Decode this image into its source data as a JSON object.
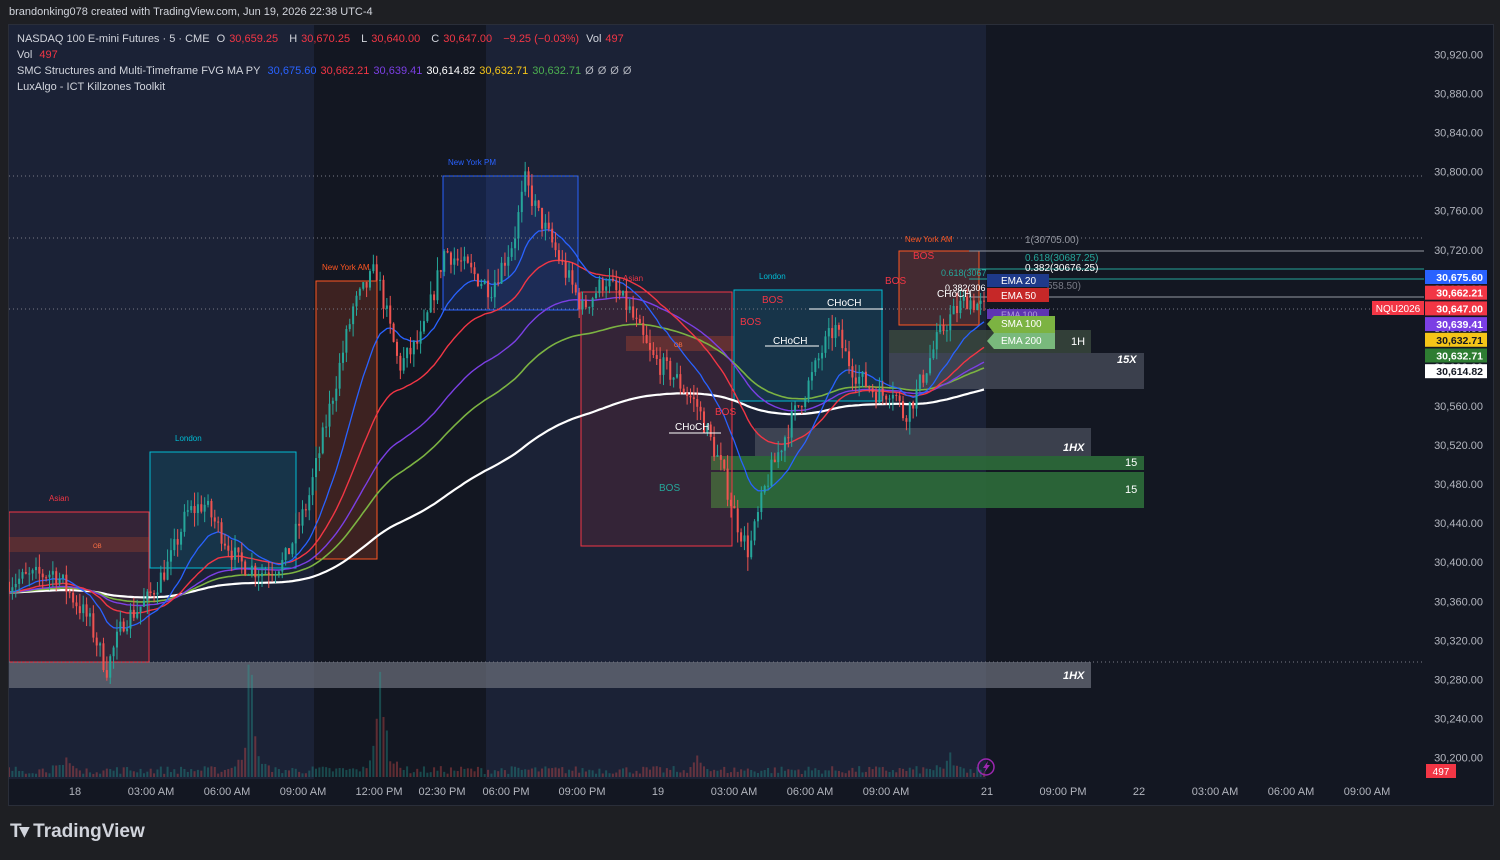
{
  "attribution": "brandonking078 created with TradingView.com, Jun 19, 2026 22:38 UTC-4",
  "legend": {
    "symbol": "NASDAQ 100 E-mini Futures · 5 · CME",
    "o_label": "O",
    "o": "30,659.25",
    "h_label": "H",
    "h": "30,670.25",
    "l_label": "L",
    "l": "30,640.00",
    "c_label": "C",
    "c": "30,647.00",
    "change": "−9.25 (−0.03%)",
    "vol_label": "Vol",
    "vol": "497",
    "vol_row_label": "Vol",
    "vol_row_value": "497",
    "indicator1": "SMC Structures and Multi-Timeframe FVG MA PY",
    "indicator1_values": [
      {
        "text": "30,675.60",
        "color": "#2962ff"
      },
      {
        "text": "30,662.21",
        "color": "#f23645"
      },
      {
        "text": "30,639.41",
        "color": "#7b3fe4"
      },
      {
        "text": "30,614.82",
        "color": "#ffffff"
      },
      {
        "text": "30,632.71",
        "color": "#f5c518"
      },
      {
        "text": "30,632.71",
        "color": "#4caf50"
      },
      {
        "text": "Ø",
        "color": "#b2b5be"
      },
      {
        "text": "Ø",
        "color": "#b2b5be"
      },
      {
        "text": "Ø",
        "color": "#b2b5be"
      },
      {
        "text": "Ø",
        "color": "#b2b5be"
      }
    ],
    "indicator2": "LuxAlgo - ICT Killzones Toolkit"
  },
  "price_axis": {
    "ticks": [
      "30,920.00",
      "30,880.00",
      "30,840.00",
      "30,800.00",
      "30,760.00",
      "30,720.00",
      "30,680.00",
      "30,640.00",
      "30,600.00",
      "30,560.00",
      "30,520.00",
      "30,480.00",
      "30,440.00",
      "30,400.00",
      "30,360.00",
      "30,320.00",
      "30,280.00",
      "30,240.00",
      "30,200.00"
    ],
    "badges": [
      {
        "text": "30,675.60",
        "color": "#2962ff",
        "value": 30675.6
      },
      {
        "text": "30,662.21",
        "color": "#f23645",
        "value": 30662.21
      },
      {
        "text": "30,647.00",
        "color": "#f23645",
        "value": 30647
      },
      {
        "text": "30,639.41",
        "color": "#7b3fe4",
        "value": 30639.41
      },
      {
        "text": "30,632.71",
        "color": "#f5c518",
        "value": 30632.71
      },
      {
        "text": "30,632.71",
        "color": "#2e7d32",
        "value": 30632.71
      },
      {
        "text": "30,614.82",
        "color": "#ffffff",
        "value": 30614.82
      }
    ],
    "symbol_badge": "NQU2026",
    "volume_badge": "497"
  },
  "time_axis": {
    "labels": [
      "18",
      "03:00 AM",
      "06:00 AM",
      "09:00 AM",
      "12:00 PM",
      "02:30 PM",
      "06:00 PM",
      "09:00 PM",
      "19",
      "03:00 AM",
      "06:00 AM",
      "09:00 AM",
      "21",
      "09:00 PM",
      "22",
      "03:00 AM",
      "06:00 AM",
      "09:00 AM"
    ]
  },
  "sessions": [
    {
      "label": "Asian",
      "color": "#f23645"
    },
    {
      "label": "London",
      "color": "#00bcd4"
    },
    {
      "label": "New York AM",
      "color": "#ff5722"
    },
    {
      "label": "New York PM",
      "color": "#2962ff"
    },
    {
      "label": "Asian",
      "color": "#f23645"
    },
    {
      "label": "London",
      "color": "#00bcd4"
    },
    {
      "label": "New York AM",
      "color": "#ff5722"
    }
  ],
  "structure_labels": [
    "OB",
    "OB",
    "CHoCH",
    "BOS",
    "BOS",
    "BOS",
    "CHoCH",
    "BOS",
    "CHoCH",
    "BOS",
    "BOS",
    "CHoCH"
  ],
  "fib_labels": [
    "1(30705.00)",
    "0.618(30687.25)",
    "0.382(30676.25)",
    "0.618(3067",
    "0.382(306",
    "558.50)"
  ],
  "ma_labels": [
    "EMA 20",
    "EMA 50",
    "EMA 100",
    "SMA 100",
    "EMA 200"
  ],
  "fvg_labels": [
    "1H",
    "15X",
    "1HX",
    "15",
    "15",
    "1HX"
  ],
  "footer": {
    "logo_text": "TradingView"
  },
  "chart_data": {
    "type": "candlestick",
    "title": "NASDAQ 100 E-mini Futures · 5 · CME",
    "ylim": [
      30180,
      30940
    ],
    "last_close": 30647,
    "series": [
      {
        "name": "SMC Structures and Multi-Timeframe FVG MA PY (EMA 20)",
        "last": 30675.6,
        "color": "#2962ff"
      },
      {
        "name": "SMC Structures and Multi-Timeframe FVG MA PY (EMA 50)",
        "last": 30662.21,
        "color": "#f23645"
      },
      {
        "name": "SMC Structures and Multi-Timeframe FVG MA PY (EMA 100)",
        "last": 30639.41,
        "color": "#7b3fe4"
      },
      {
        "name": "SMC Structures and Multi-Timeframe FVG MA PY (SMA 100)",
        "last": 30632.71,
        "color": "#f5c518"
      },
      {
        "name": "SMC Structures and Multi-Timeframe FVG MA PY (EMA 200)",
        "last": 30614.82,
        "color": "#ffffff"
      }
    ],
    "price_path": [
      [
        0,
        30380
      ],
      [
        0.04,
        30390
      ],
      [
        0.07,
        30340
      ],
      [
        0.085,
        30290
      ],
      [
        0.1,
        30340
      ],
      [
        0.12,
        30360
      ],
      [
        0.14,
        30400
      ],
      [
        0.155,
        30450
      ],
      [
        0.17,
        30460
      ],
      [
        0.19,
        30420
      ],
      [
        0.2,
        30400
      ],
      [
        0.22,
        30390
      ],
      [
        0.24,
        30400
      ],
      [
        0.26,
        30460
      ],
      [
        0.28,
        30560
      ],
      [
        0.3,
        30660
      ],
      [
        0.32,
        30700
      ],
      [
        0.34,
        30600
      ],
      [
        0.36,
        30630
      ],
      [
        0.38,
        30720
      ],
      [
        0.4,
        30700
      ],
      [
        0.42,
        30680
      ],
      [
        0.44,
        30730
      ],
      [
        0.45,
        30790
      ],
      [
        0.46,
        30760
      ],
      [
        0.48,
        30710
      ],
      [
        0.5,
        30660
      ],
      [
        0.52,
        30690
      ],
      [
        0.54,
        30660
      ],
      [
        0.56,
        30610
      ],
      [
        0.58,
        30590
      ],
      [
        0.6,
        30560
      ],
      [
        0.62,
        30500
      ],
      [
        0.635,
        30440
      ],
      [
        0.645,
        30410
      ],
      [
        0.66,
        30480
      ],
      [
        0.68,
        30540
      ],
      [
        0.7,
        30590
      ],
      [
        0.71,
        30620
      ],
      [
        0.72,
        30640
      ],
      [
        0.73,
        30610
      ],
      [
        0.74,
        30590
      ],
      [
        0.76,
        30570
      ],
      [
        0.77,
        30580
      ],
      [
        0.78,
        30550
      ],
      [
        0.79,
        30570
      ],
      [
        0.8,
        30600
      ],
      [
        0.81,
        30630
      ],
      [
        0.82,
        30650
      ],
      [
        0.835,
        30670
      ],
      [
        0.85,
        30660
      ]
    ],
    "volume_peaks": [
      [
        0.21,
        165
      ],
      [
        0.325,
        185
      ],
      [
        0.05,
        20
      ],
      [
        0.6,
        16
      ],
      [
        0.82,
        20
      ]
    ]
  }
}
